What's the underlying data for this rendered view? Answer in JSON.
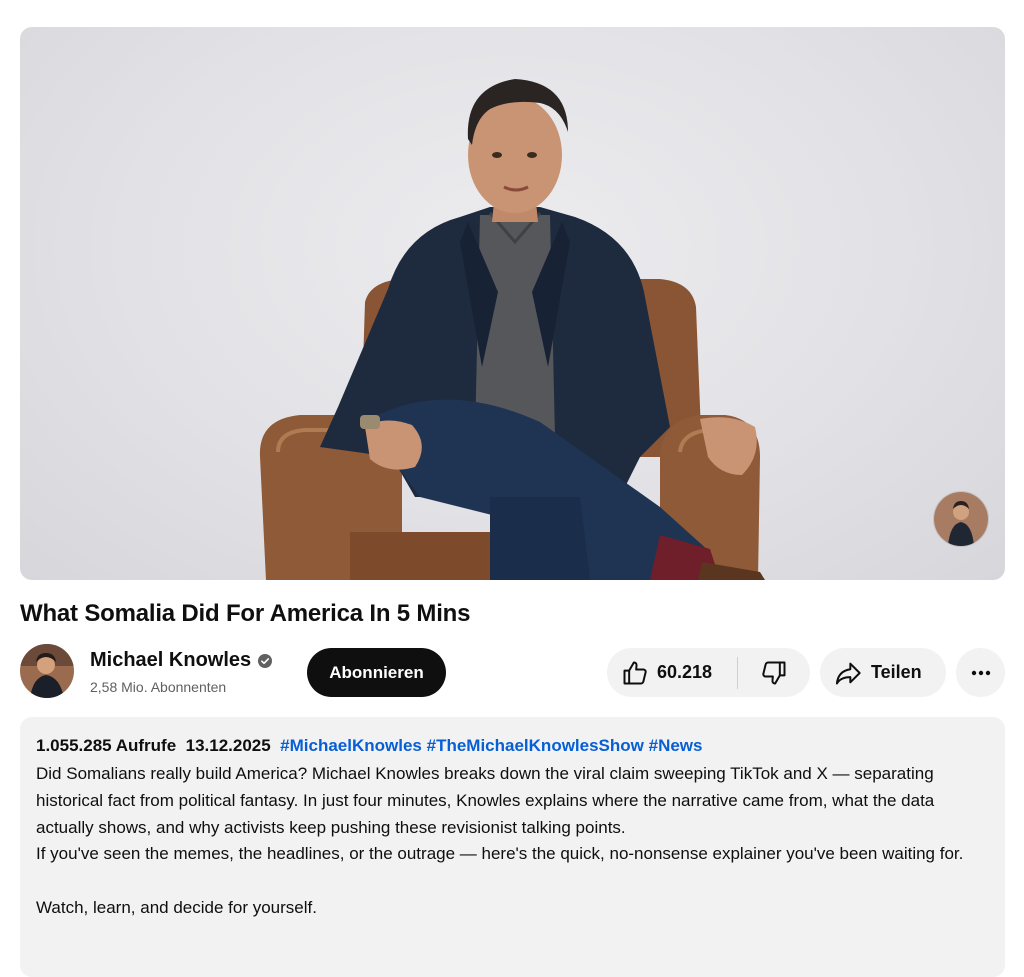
{
  "video": {
    "title": "What Somalia Did For America In 5 Mins"
  },
  "channel": {
    "name": "Michael Knowles",
    "subscribers": "2,58 Mio. Abonnenten",
    "subscribe_label": "Abonnieren",
    "verified_icon": "verified-check-icon"
  },
  "actions": {
    "like_count": "60.218",
    "share_label": "Teilen"
  },
  "description": {
    "views": "1.055.285 Aufrufe",
    "date": "13.12.2025",
    "hashtags": [
      "#MichaelKnowles",
      "#TheMichaelKnowlesShow",
      "#News"
    ],
    "paragraph1": "Did Somalians really build America? Michael Knowles breaks down the viral claim sweeping TikTok and X — separating historical fact from political fantasy. In just four minutes, Knowles explains where the narrative came from, what the data actually shows, and why activists keep pushing these revisionist talking points.",
    "paragraph2": "If you've seen the memes, the headlines, or the outrage — here's the quick, no-nonsense explainer you've been waiting for.",
    "paragraph3": "Watch, learn, and decide for yourself."
  },
  "colors": {
    "link": "#065fd4",
    "subscribe_bg": "#0f0f0f",
    "pill_bg": "#f2f2f2"
  }
}
